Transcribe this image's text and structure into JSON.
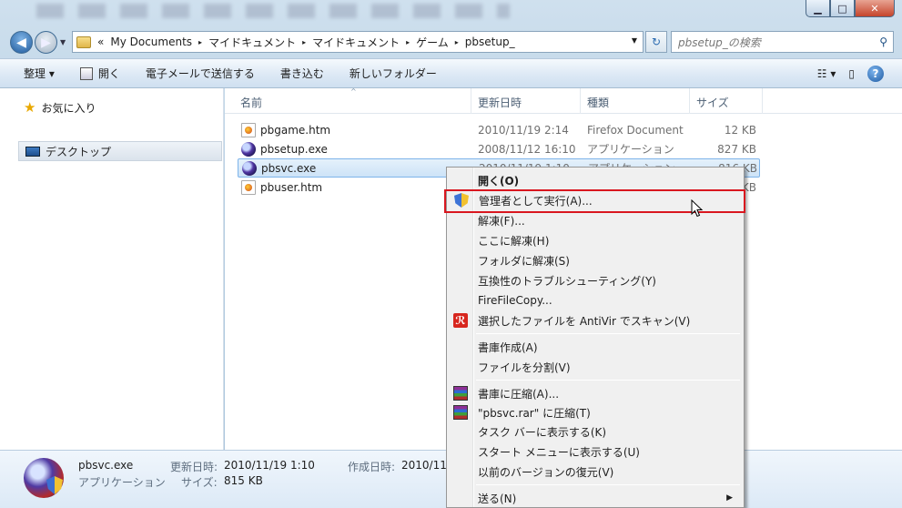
{
  "window": {
    "buttons": {
      "minimize": "▁",
      "maximize": "□",
      "close": "✕"
    }
  },
  "nav": {
    "back_icon": "◀",
    "forward_icon": "▶",
    "history_dropdown": "▼",
    "breadcrumb_overflow": "«",
    "breadcrumb": [
      "My Documents",
      "マイドキュメント",
      "マイドキュメント",
      "ゲーム",
      "pbsetup_"
    ],
    "crumb_separator": "▸",
    "address_dropdown": "▼",
    "refresh_icon": "↻",
    "search_placeholder": "pbsetup_の検索",
    "search_icon": "⚲"
  },
  "commands": {
    "organize": "整理 ▾",
    "open": "開く",
    "email": "電子メールで送信する",
    "burn": "書き込む",
    "new_folder": "新しいフォルダー",
    "views_icon": "☷ ▾",
    "preview_icon": "▯",
    "help_icon": "?"
  },
  "sidebar": {
    "favorites": "お気に入り",
    "desktop": "デスクトップ"
  },
  "columns": {
    "name": "名前",
    "date": "更新日時",
    "type": "種類",
    "size": "サイズ",
    "sort_indicator": "^"
  },
  "files": [
    {
      "name": "pbgame.htm",
      "date": "2010/11/19 2:14",
      "type": "Firefox Document",
      "size": "12 KB",
      "icon": "firefox-doc-icon"
    },
    {
      "name": "pbsetup.exe",
      "date": "2008/11/12 16:10",
      "type": "アプリケーション",
      "size": "827 KB",
      "icon": "app-icon"
    },
    {
      "name": "pbsvc.exe",
      "date": "2010/11/19 1:10",
      "type": "アプリケーション",
      "size": "816 KB",
      "icon": "app-icon"
    },
    {
      "name": "pbuser.htm",
      "date": "",
      "type": "",
      "size": "KB",
      "icon": "firefox-doc-icon"
    }
  ],
  "details": {
    "file_name": "pbsvc.exe",
    "modified_label": "更新日時:",
    "modified": "2010/11/19 1:10",
    "created_label": "作成日時:",
    "created": "2010/11/",
    "type": "アプリケーション",
    "size_label": "サイズ:",
    "size": "815 KB"
  },
  "context_menu": {
    "items": [
      {
        "label": "開く(O)",
        "default": true
      },
      {
        "label": "管理者として実行(A)...",
        "icon": "uac-shield-icon",
        "highlighted": true
      },
      {
        "label": "解凍(F)..."
      },
      {
        "label": "ここに解凍(H)"
      },
      {
        "label": "フォルダに解凍(S)"
      },
      {
        "label": "互換性のトラブルシューティング(Y)"
      },
      {
        "label": "FireFileCopy..."
      },
      {
        "label": "選択したファイルを AntiVir でスキャン(V)",
        "icon": "antivir-icon"
      },
      {
        "label": "書庫作成(A)"
      },
      {
        "label": "ファイルを分割(V)"
      },
      {
        "label": "書庫に圧縮(A)...",
        "icon": "winrar-icon"
      },
      {
        "label": "\"pbsvc.rar\" に圧縮(T)",
        "icon": "winrar-icon"
      },
      {
        "label": "タスク バーに表示する(K)"
      },
      {
        "label": "スタート メニューに表示する(U)"
      },
      {
        "label": "以前のバージョンの復元(V)"
      },
      {
        "label": "送る(N)",
        "submenu": true
      }
    ],
    "antivir_glyph": "ℛ",
    "submenu_arrow": "▶"
  },
  "colors": {
    "highlight_border": "#d9171f",
    "selection": "#cde3f7"
  }
}
